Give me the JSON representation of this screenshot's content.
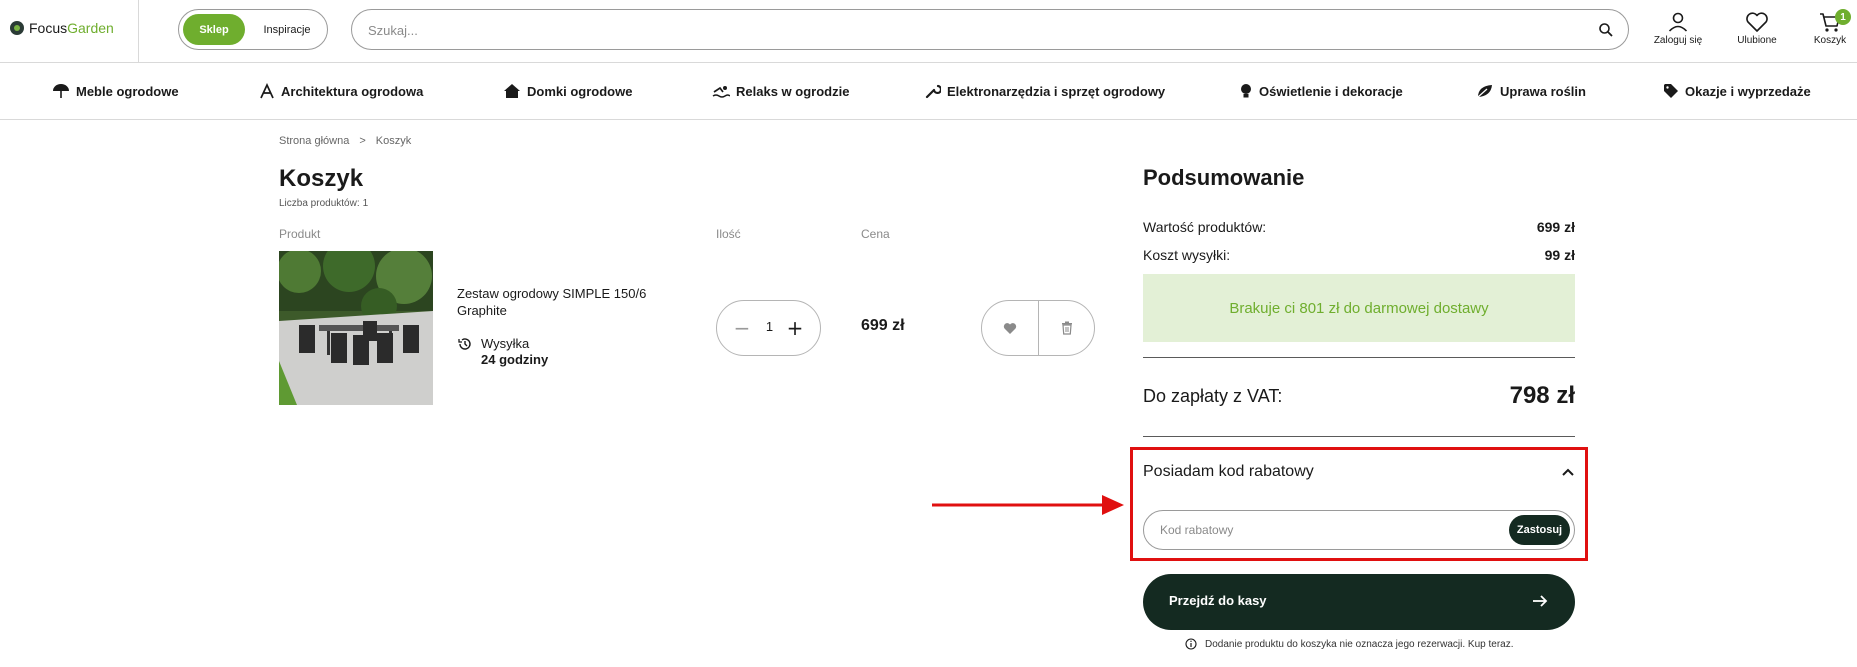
{
  "header": {
    "logo_focus": "Focus",
    "logo_garden": "Garden",
    "switch_active": "Sklep",
    "switch_inactive": "Inspiracje",
    "search_placeholder": "Szukaj...",
    "login_label": "Zaloguj się",
    "favorites_label": "Ulubione",
    "cart_label": "Koszyk",
    "cart_count": "1"
  },
  "categories": [
    {
      "label": "Meble ogrodowe",
      "icon": "umbrella-icon"
    },
    {
      "label": "Architektura ogrodowa",
      "icon": "pergola-icon"
    },
    {
      "label": "Domki ogrodowe",
      "icon": "house-icon"
    },
    {
      "label": "Relaks w ogrodzie",
      "icon": "swimmer-icon"
    },
    {
      "label": "Elektronarzędzia i sprzęt ogrodowy",
      "icon": "wrench-icon"
    },
    {
      "label": "Oświetlenie i dekoracje",
      "icon": "bulb-icon"
    },
    {
      "label": "Uprawa roślin",
      "icon": "leaf-icon"
    },
    {
      "label": "Okazje i wyprzedaże",
      "icon": "tag-icon"
    }
  ],
  "breadcrumb": {
    "home": "Strona główna",
    "separator": ">",
    "current": "Koszyk"
  },
  "cart": {
    "title": "Koszyk",
    "count_label": "Liczba produktów:",
    "count_value": "1",
    "col_product": "Produkt",
    "col_qty": "Ilość",
    "col_price": "Cena",
    "item": {
      "name": "Zestaw ogrodowy SIMPLE 150/6 Graphite",
      "shipping_label": "Wysyłka",
      "shipping_time": "24 godziny",
      "quantity": "1",
      "price": "699 zł"
    }
  },
  "summary": {
    "title": "Podsumowanie",
    "products_label": "Wartość produktów:",
    "products_value": "699 zł",
    "shipping_label": "Koszt wysyłki:",
    "shipping_value": "99 zł",
    "free_shipping_note": "Brakuje ci 801 zł do darmowej dostawy",
    "total_label": "Do zapłaty z VAT:",
    "total_value": "798 zł",
    "discount_toggle": "Posiadam kod rabatowy",
    "discount_placeholder": "Kod rabatowy",
    "apply_label": "Zastosuj",
    "checkout_label": "Przejdź do kasy",
    "reservation_note": "Dodanie produktu do koszyka nie oznacza jego rezerwacji. Kup teraz."
  },
  "colors": {
    "brand_green": "#6fae2e",
    "dark": "#142a21",
    "highlight_red": "#e01010",
    "free_ship_bg": "#e3f0d6"
  }
}
